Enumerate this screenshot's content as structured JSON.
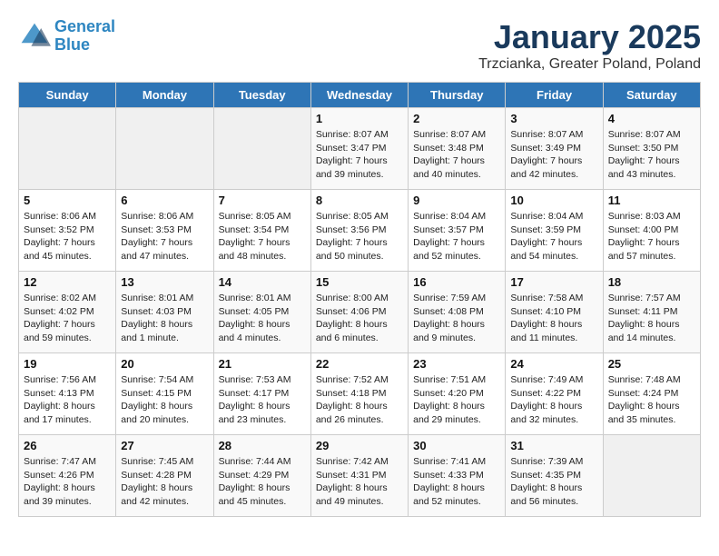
{
  "header": {
    "logo_line1": "General",
    "logo_line2": "Blue",
    "title": "January 2025",
    "subtitle": "Trzcianka, Greater Poland, Poland"
  },
  "days_of_week": [
    "Sunday",
    "Monday",
    "Tuesday",
    "Wednesday",
    "Thursday",
    "Friday",
    "Saturday"
  ],
  "weeks": [
    [
      {
        "day": "",
        "empty": true
      },
      {
        "day": "",
        "empty": true
      },
      {
        "day": "",
        "empty": true
      },
      {
        "day": "1",
        "sunrise": "8:07 AM",
        "sunset": "3:47 PM",
        "daylight": "7 hours and 39 minutes."
      },
      {
        "day": "2",
        "sunrise": "8:07 AM",
        "sunset": "3:48 PM",
        "daylight": "7 hours and 40 minutes."
      },
      {
        "day": "3",
        "sunrise": "8:07 AM",
        "sunset": "3:49 PM",
        "daylight": "7 hours and 42 minutes."
      },
      {
        "day": "4",
        "sunrise": "8:07 AM",
        "sunset": "3:50 PM",
        "daylight": "7 hours and 43 minutes."
      }
    ],
    [
      {
        "day": "5",
        "sunrise": "8:06 AM",
        "sunset": "3:52 PM",
        "daylight": "7 hours and 45 minutes."
      },
      {
        "day": "6",
        "sunrise": "8:06 AM",
        "sunset": "3:53 PM",
        "daylight": "7 hours and 47 minutes."
      },
      {
        "day": "7",
        "sunrise": "8:05 AM",
        "sunset": "3:54 PM",
        "daylight": "7 hours and 48 minutes."
      },
      {
        "day": "8",
        "sunrise": "8:05 AM",
        "sunset": "3:56 PM",
        "daylight": "7 hours and 50 minutes."
      },
      {
        "day": "9",
        "sunrise": "8:04 AM",
        "sunset": "3:57 PM",
        "daylight": "7 hours and 52 minutes."
      },
      {
        "day": "10",
        "sunrise": "8:04 AM",
        "sunset": "3:59 PM",
        "daylight": "7 hours and 54 minutes."
      },
      {
        "day": "11",
        "sunrise": "8:03 AM",
        "sunset": "4:00 PM",
        "daylight": "7 hours and 57 minutes."
      }
    ],
    [
      {
        "day": "12",
        "sunrise": "8:02 AM",
        "sunset": "4:02 PM",
        "daylight": "7 hours and 59 minutes."
      },
      {
        "day": "13",
        "sunrise": "8:01 AM",
        "sunset": "4:03 PM",
        "daylight": "8 hours and 1 minute."
      },
      {
        "day": "14",
        "sunrise": "8:01 AM",
        "sunset": "4:05 PM",
        "daylight": "8 hours and 4 minutes."
      },
      {
        "day": "15",
        "sunrise": "8:00 AM",
        "sunset": "4:06 PM",
        "daylight": "8 hours and 6 minutes."
      },
      {
        "day": "16",
        "sunrise": "7:59 AM",
        "sunset": "4:08 PM",
        "daylight": "8 hours and 9 minutes."
      },
      {
        "day": "17",
        "sunrise": "7:58 AM",
        "sunset": "4:10 PM",
        "daylight": "8 hours and 11 minutes."
      },
      {
        "day": "18",
        "sunrise": "7:57 AM",
        "sunset": "4:11 PM",
        "daylight": "8 hours and 14 minutes."
      }
    ],
    [
      {
        "day": "19",
        "sunrise": "7:56 AM",
        "sunset": "4:13 PM",
        "daylight": "8 hours and 17 minutes."
      },
      {
        "day": "20",
        "sunrise": "7:54 AM",
        "sunset": "4:15 PM",
        "daylight": "8 hours and 20 minutes."
      },
      {
        "day": "21",
        "sunrise": "7:53 AM",
        "sunset": "4:17 PM",
        "daylight": "8 hours and 23 minutes."
      },
      {
        "day": "22",
        "sunrise": "7:52 AM",
        "sunset": "4:18 PM",
        "daylight": "8 hours and 26 minutes."
      },
      {
        "day": "23",
        "sunrise": "7:51 AM",
        "sunset": "4:20 PM",
        "daylight": "8 hours and 29 minutes."
      },
      {
        "day": "24",
        "sunrise": "7:49 AM",
        "sunset": "4:22 PM",
        "daylight": "8 hours and 32 minutes."
      },
      {
        "day": "25",
        "sunrise": "7:48 AM",
        "sunset": "4:24 PM",
        "daylight": "8 hours and 35 minutes."
      }
    ],
    [
      {
        "day": "26",
        "sunrise": "7:47 AM",
        "sunset": "4:26 PM",
        "daylight": "8 hours and 39 minutes."
      },
      {
        "day": "27",
        "sunrise": "7:45 AM",
        "sunset": "4:28 PM",
        "daylight": "8 hours and 42 minutes."
      },
      {
        "day": "28",
        "sunrise": "7:44 AM",
        "sunset": "4:29 PM",
        "daylight": "8 hours and 45 minutes."
      },
      {
        "day": "29",
        "sunrise": "7:42 AM",
        "sunset": "4:31 PM",
        "daylight": "8 hours and 49 minutes."
      },
      {
        "day": "30",
        "sunrise": "7:41 AM",
        "sunset": "4:33 PM",
        "daylight": "8 hours and 52 minutes."
      },
      {
        "day": "31",
        "sunrise": "7:39 AM",
        "sunset": "4:35 PM",
        "daylight": "8 hours and 56 minutes."
      },
      {
        "day": "",
        "empty": true
      }
    ]
  ]
}
